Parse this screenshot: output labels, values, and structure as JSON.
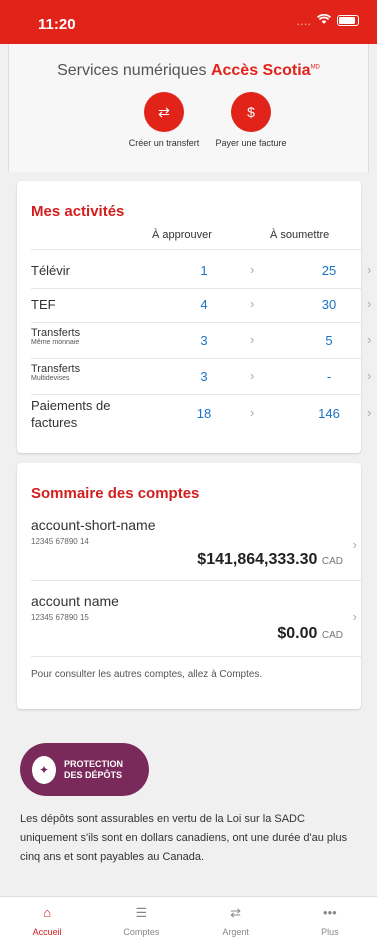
{
  "status": {
    "time": "11:20",
    "signal": "....",
    "wifi": "wifi-icon",
    "battery": "battery-icon"
  },
  "header": {
    "prefix": "Services numériques",
    "brand": "Accès Scotia",
    "sup": "MD"
  },
  "actions": [
    {
      "label": "Créer un transfert",
      "icon": "transfer-icon"
    },
    {
      "label": "Payer une facture",
      "icon": "bill-icon"
    }
  ],
  "activities": {
    "title": "Mes activités",
    "col_approve": "À approuver",
    "col_submit": "À soumettre",
    "rows": [
      {
        "label": "Télévir",
        "sub": "",
        "approve": "1",
        "submit": "25"
      },
      {
        "label": "TEF",
        "sub": "",
        "approve": "4",
        "submit": "30"
      },
      {
        "label": "Transferts",
        "sub": "Même monnaie",
        "approve": "3",
        "submit": "5"
      },
      {
        "label": "Transferts",
        "sub": "Multidevises",
        "approve": "3",
        "submit": "-"
      },
      {
        "label": "Paiements de factures",
        "sub": "",
        "approve": "18",
        "submit": "146"
      }
    ]
  },
  "accounts": {
    "title": "Sommaire des comptes",
    "items": [
      {
        "name": "account-short-name",
        "number": "12345 67890 14",
        "balance": "$141,864,333.30",
        "currency": "CAD"
      },
      {
        "name": "account name",
        "number": "12345 67890 15",
        "balance": "$0.00",
        "currency": "CAD"
      }
    ],
    "footer": "Pour consulter les autres comptes, allez à Comptes."
  },
  "cdic": {
    "badge_line1": "PROTECTION",
    "badge_line2": "DES DÉPÔTS",
    "text": "Les dépôts sont assurables en vertu de la Loi sur la SADC uniquement s'ils sont en dollars canadiens, ont une durée d'au plus cinq ans et sont payables au Canada."
  },
  "tabs": [
    {
      "label": "Accueil",
      "icon": "home-icon",
      "active": true
    },
    {
      "label": "Comptes",
      "icon": "list-icon",
      "active": false
    },
    {
      "label": "Argent",
      "icon": "transfer-arrows-icon",
      "active": false
    },
    {
      "label": "Plus",
      "icon": "more-icon",
      "active": false
    }
  ],
  "colors": {
    "brand_red": "#e2231a",
    "link_blue": "#1a73c8",
    "cdic_purple": "#7a2a5a"
  }
}
